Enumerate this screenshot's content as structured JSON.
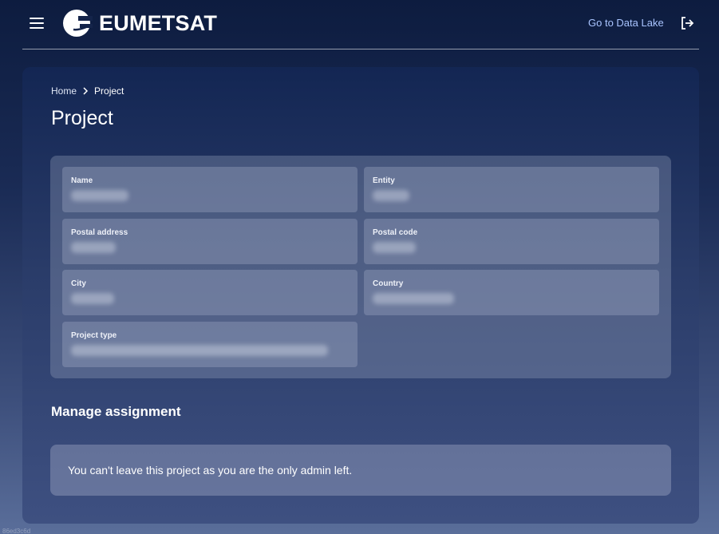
{
  "header": {
    "brand": "EUMETSAT",
    "data_lake_link": "Go to Data Lake",
    "icons": {
      "menu": "hamburger-menu-icon",
      "logout": "logout-icon"
    }
  },
  "breadcrumb": {
    "home": "Home",
    "current": "Project"
  },
  "page": {
    "title": "Project"
  },
  "fields": [
    {
      "label": "Name"
    },
    {
      "label": "Entity"
    },
    {
      "label": "Postal address"
    },
    {
      "label": "Postal code"
    },
    {
      "label": "City"
    },
    {
      "label": "Country"
    },
    {
      "label": "Project type"
    }
  ],
  "manage": {
    "title": "Manage assignment",
    "message": "You can't leave this project as you are the only admin left."
  },
  "footer": {
    "build_id": "86ed3c6d"
  }
}
